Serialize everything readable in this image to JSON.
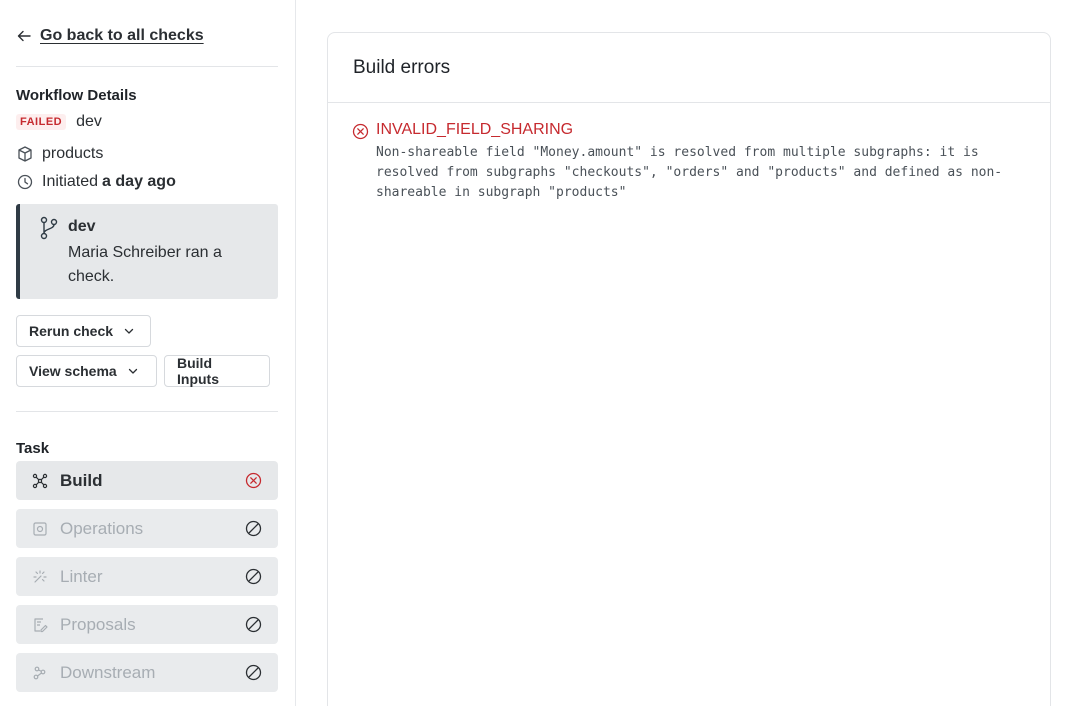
{
  "sidebar": {
    "back_label": "Go back to all checks",
    "workflow_title": "Workflow Details",
    "status_badge": "FAILED",
    "variant": "dev",
    "graph": "products",
    "initiated_prefix": "Initiated",
    "initiated_time": "a day ago",
    "commit": {
      "branch": "dev",
      "message": "Maria Schreiber ran a check."
    },
    "buttons": {
      "rerun": "Rerun check",
      "view_schema": "View schema",
      "build_inputs": "Build Inputs"
    },
    "task_title": "Task",
    "tasks": [
      {
        "label": "Build",
        "icon": "build-icon",
        "status": "error"
      },
      {
        "label": "Operations",
        "icon": "operations-icon",
        "status": "skipped"
      },
      {
        "label": "Linter",
        "icon": "linter-icon",
        "status": "skipped"
      },
      {
        "label": "Proposals",
        "icon": "proposals-icon",
        "status": "skipped"
      },
      {
        "label": "Downstream",
        "icon": "downstream-icon",
        "status": "skipped"
      }
    ]
  },
  "main": {
    "title": "Build errors",
    "errors": [
      {
        "code": "INVALID_FIELD_SHARING",
        "message": "Non-shareable field \"Money.amount\" is resolved from multiple subgraphs: it is resolved from subgraphs \"checkouts\", \"orders\" and \"products\" and defined as non-shareable in subgraph \"products\""
      }
    ]
  },
  "colors": {
    "error": "#c62a2f",
    "accent_border": "#2f3b45",
    "task_bg": "#e6e8ea",
    "disabled_text": "#a7adb3"
  }
}
